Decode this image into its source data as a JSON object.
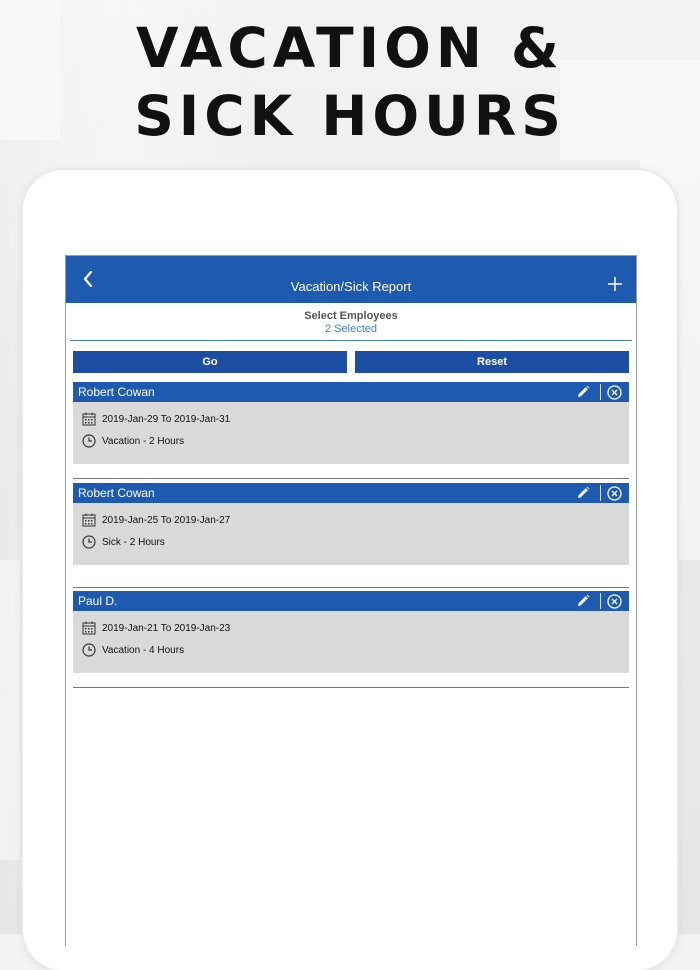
{
  "headline": {
    "line1": "VACATION &",
    "line2": "SICK HOURS"
  },
  "navbar": {
    "title": "Vacation/Sick Report",
    "back_icon": "chevron-left-icon",
    "add_icon": "plus-icon"
  },
  "select": {
    "label": "Select Employees",
    "count": "2 Selected"
  },
  "buttons": {
    "go": "Go",
    "reset": "Reset"
  },
  "entries": [
    {
      "name": "Robert Cowan",
      "dates": "2019-Jan-29 To 2019-Jan-31",
      "type": "Vacation - 2 Hours"
    },
    {
      "name": "Robert Cowan",
      "dates": "2019-Jan-25 To 2019-Jan-27",
      "type": "Sick - 2 Hours"
    },
    {
      "name": "Paul D.",
      "dates": "2019-Jan-21 To 2019-Jan-23",
      "type": "Vacation - 4 Hours"
    }
  ],
  "colors": {
    "navbar": "#1e5bb0",
    "button": "#1d4ea3",
    "card_body": "#d9d9d9",
    "accent_text": "#3d7bd1"
  }
}
